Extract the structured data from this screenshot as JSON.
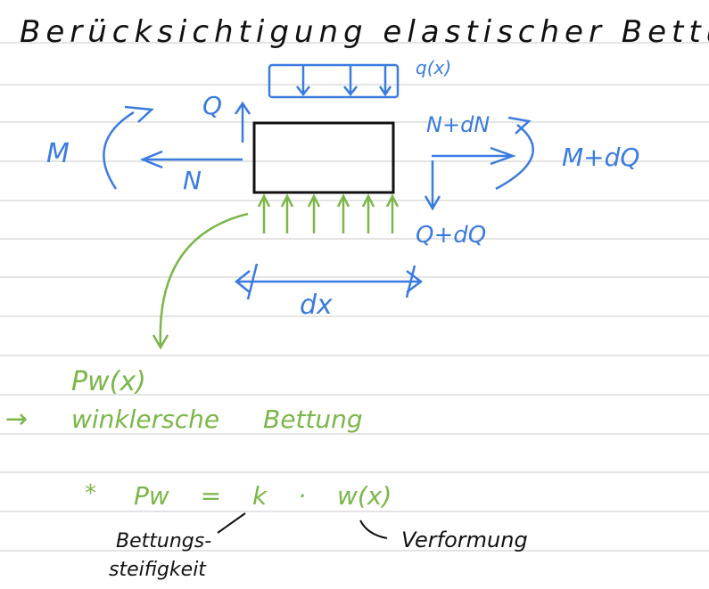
{
  "title": "Berücksichtigung elastischer Bettung",
  "colors": {
    "ink": "#111111",
    "blue": "#3a7be0",
    "green": "#7ab648",
    "line": "#c9c9c9"
  },
  "diagram": {
    "load_label": "q(x)",
    "shear_left": "Q",
    "moment_left": "M",
    "normal_left": "N",
    "normal_right": "N+dN",
    "moment_right": "M+dQ",
    "shear_right": "Q+dQ",
    "length_label": "dx"
  },
  "notes": {
    "pressure": "Pw(x)",
    "arrow_glyph": "→",
    "model": "winklersche Bettung",
    "formula_star": "*",
    "formula": "Pw = k · w(x)",
    "stiffness_line1": "Bettungs-",
    "stiffness_line2": "steifigkeit",
    "deformation": "Verformung"
  }
}
